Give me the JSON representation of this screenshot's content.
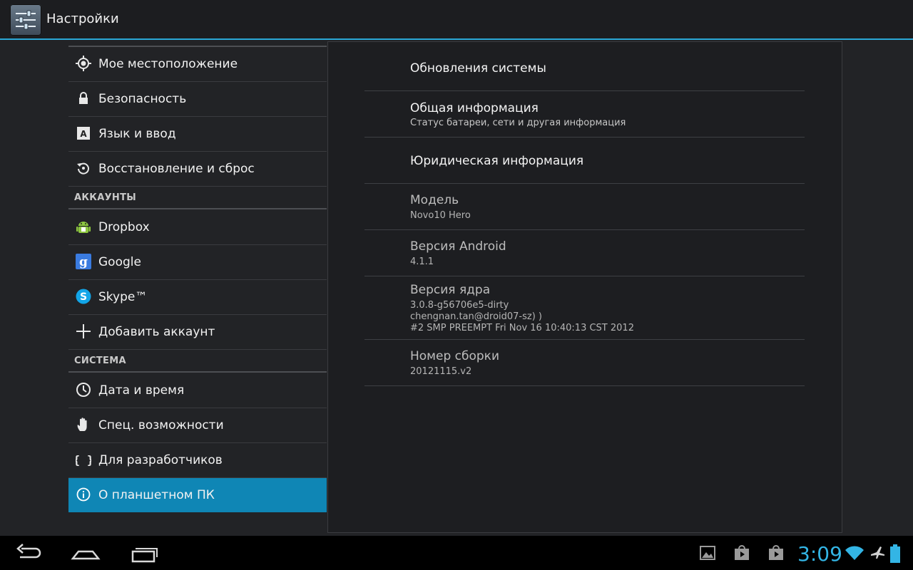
{
  "action_bar": {
    "title": "Настройки",
    "icon": "settings-sliders-icon"
  },
  "sidebar": {
    "items_top": [
      {
        "label": "Мое местоположение",
        "icon": "location-icon"
      },
      {
        "label": "Безопасность",
        "icon": "lock-icon"
      },
      {
        "label": "Язык и ввод",
        "icon": "keyboard-a-icon"
      },
      {
        "label": "Восстановление и сброс",
        "icon": "restore-icon"
      }
    ],
    "accounts_header": "АККАУНТЫ",
    "accounts": [
      {
        "label": "Dropbox",
        "icon": "android-icon"
      },
      {
        "label": "Google",
        "icon": "google-icon"
      },
      {
        "label": "Skype™",
        "icon": "skype-icon"
      },
      {
        "label": "Добавить аккаунт",
        "icon": "plus-icon"
      }
    ],
    "system_header": "СИСТЕМА",
    "system": [
      {
        "label": "Дата и время",
        "icon": "clock-icon"
      },
      {
        "label": "Спец. возможности",
        "icon": "hand-icon"
      },
      {
        "label": "Для разработчиков",
        "icon": "braces-icon"
      },
      {
        "label": "О планшетном ПК",
        "icon": "info-icon",
        "selected": true
      }
    ]
  },
  "details": {
    "system_updates": "Обновления системы",
    "general_info": "Общая информация",
    "general_info_summary": "Статус батареи, сети и другая информация",
    "legal_info": "Юридическая информация",
    "model_label": "Модель",
    "model_value": "Novo10 Hero",
    "android_label": "Версия Android",
    "android_value": "4.1.1",
    "kernel_label": "Версия ядра",
    "kernel_line1": "3.0.8-g56706e5-dirty",
    "kernel_line2": "chengnan.tan@droid07-sz) )",
    "kernel_line3": "#2 SMP PREEMPT Fri Nov 16 10:40:13 CST 2012",
    "build_label": "Номер сборки",
    "build_value": "20121115.v2"
  },
  "navbar": {
    "clock": "3:09",
    "accent": "#33b5e5",
    "buttons": [
      "back-icon",
      "home-icon",
      "recents-icon"
    ],
    "status_icons": [
      "gallery-icon",
      "play-store-icon",
      "play-store-icon",
      "wifi-icon",
      "airplane-icon",
      "battery-icon"
    ]
  },
  "colors": {
    "selected": "#0f86b5",
    "accent_line": "#2aa7d6",
    "background": "#222326"
  }
}
